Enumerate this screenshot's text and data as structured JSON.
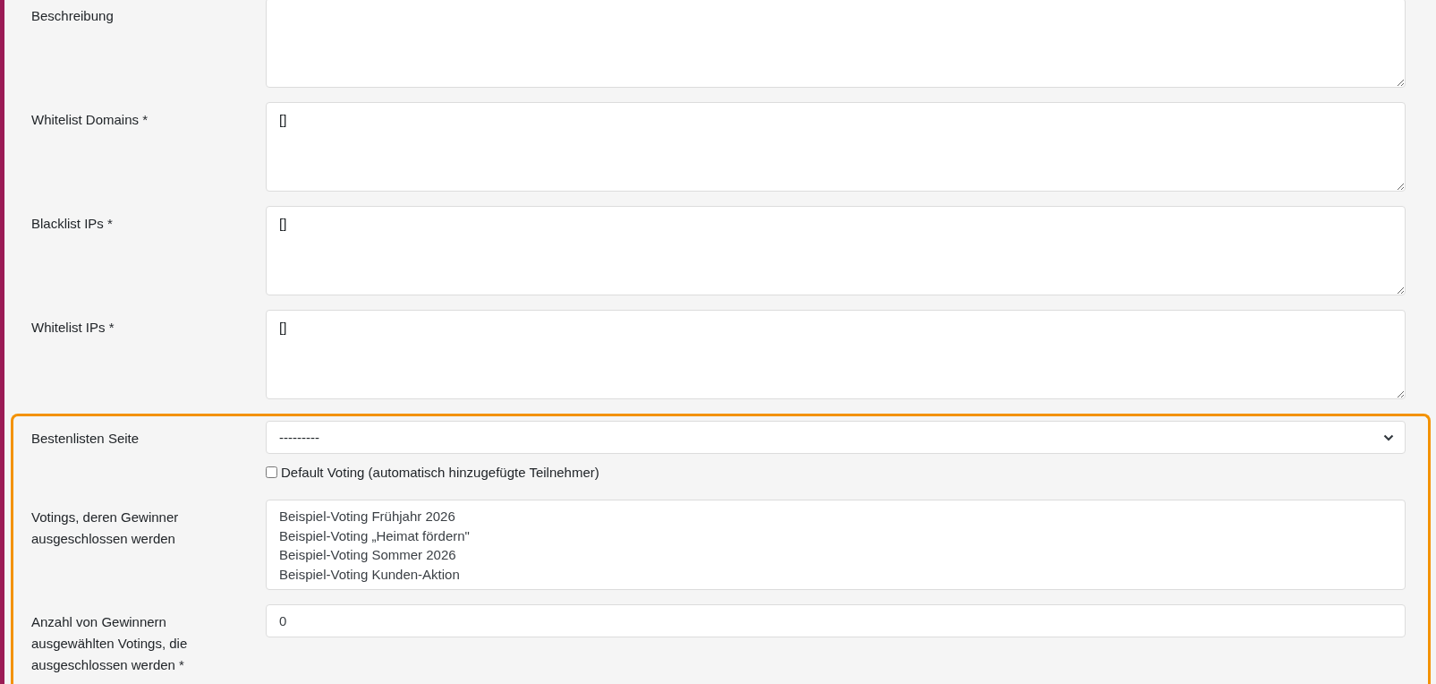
{
  "fields": [
    {
      "kind": "textarea",
      "label": "Beschreibung"
    },
    {
      "kind": "textarea",
      "label": "Whitelist Domains *",
      "value": "[]"
    },
    {
      "kind": "textarea",
      "label": "Blacklist IPs *",
      "value": "[]"
    },
    {
      "kind": "textarea",
      "label": "Whitelist IPs *",
      "value": "[]"
    }
  ],
  "highlighted_section": {
    "fields": [
      {
        "kind": "select",
        "label": "Bestenlisten Seite",
        "value": "---------"
      },
      {
        "kind": "checkbox",
        "label": "Default Voting (automatisch hinzugefügte Teilnehmer)",
        "checked": false
      },
      {
        "kind": "multiselect",
        "label": "Votings, deren Gewinner ausgeschlossen werden",
        "options": [
          {
            "label": "Beispiel-Voting Frühjahr 2026",
            "selected": false
          },
          {
            "label": "Beispiel-Voting „Heimat fördern\"",
            "selected": false
          },
          {
            "label": "Beispiel-Voting Sommer 2026",
            "selected": false
          },
          {
            "label": "Beispiel-Voting Kunden-Aktion",
            "selected": false
          }
        ]
      },
      {
        "kind": "number",
        "label": "Anzahl von Gewinnern ausgewählten Votings, die ausgeschlossen werden *",
        "value": "0"
      }
    ]
  }
}
